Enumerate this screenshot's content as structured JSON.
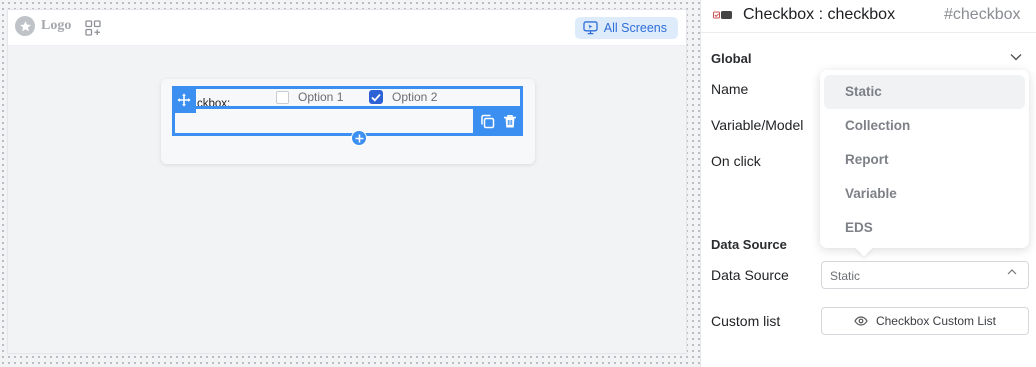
{
  "canvas": {
    "logo_text": "Logo",
    "all_screens_label": "All Screens",
    "checkbox_widget": {
      "label": "ckbox:",
      "options": [
        {
          "label": "Option 1",
          "checked": false
        },
        {
          "label": "Option 2",
          "checked": true
        }
      ]
    },
    "icons": {
      "logo": "star-icon",
      "add_widget": "add-widget-icon",
      "screens": "monitor-icon",
      "move": "move-icon",
      "copy": "copy-icon",
      "delete": "trash-icon",
      "add": "plus-icon"
    }
  },
  "panel": {
    "title": "Checkbox : checkbox",
    "id_label": "#checkbox",
    "global_section": "Global",
    "rows": {
      "name": "Name",
      "variable_model": "Variable/Model",
      "on_click": "On click"
    },
    "dropdown_options": [
      "Static",
      "Collection",
      "Report",
      "Variable",
      "EDS"
    ],
    "dropdown_highlighted": "Static",
    "data_source_section": "Data Source",
    "data_source_label": "Data Source",
    "data_source_value": "Static",
    "custom_list_label": "Custom list",
    "custom_list_button": "Checkbox Custom List"
  },
  "colors": {
    "accent": "#3b8ff0",
    "checkbox_checked": "#2c62d6",
    "all_screens_bg": "#ddebfb",
    "all_screens_text": "#2f6fd9"
  }
}
